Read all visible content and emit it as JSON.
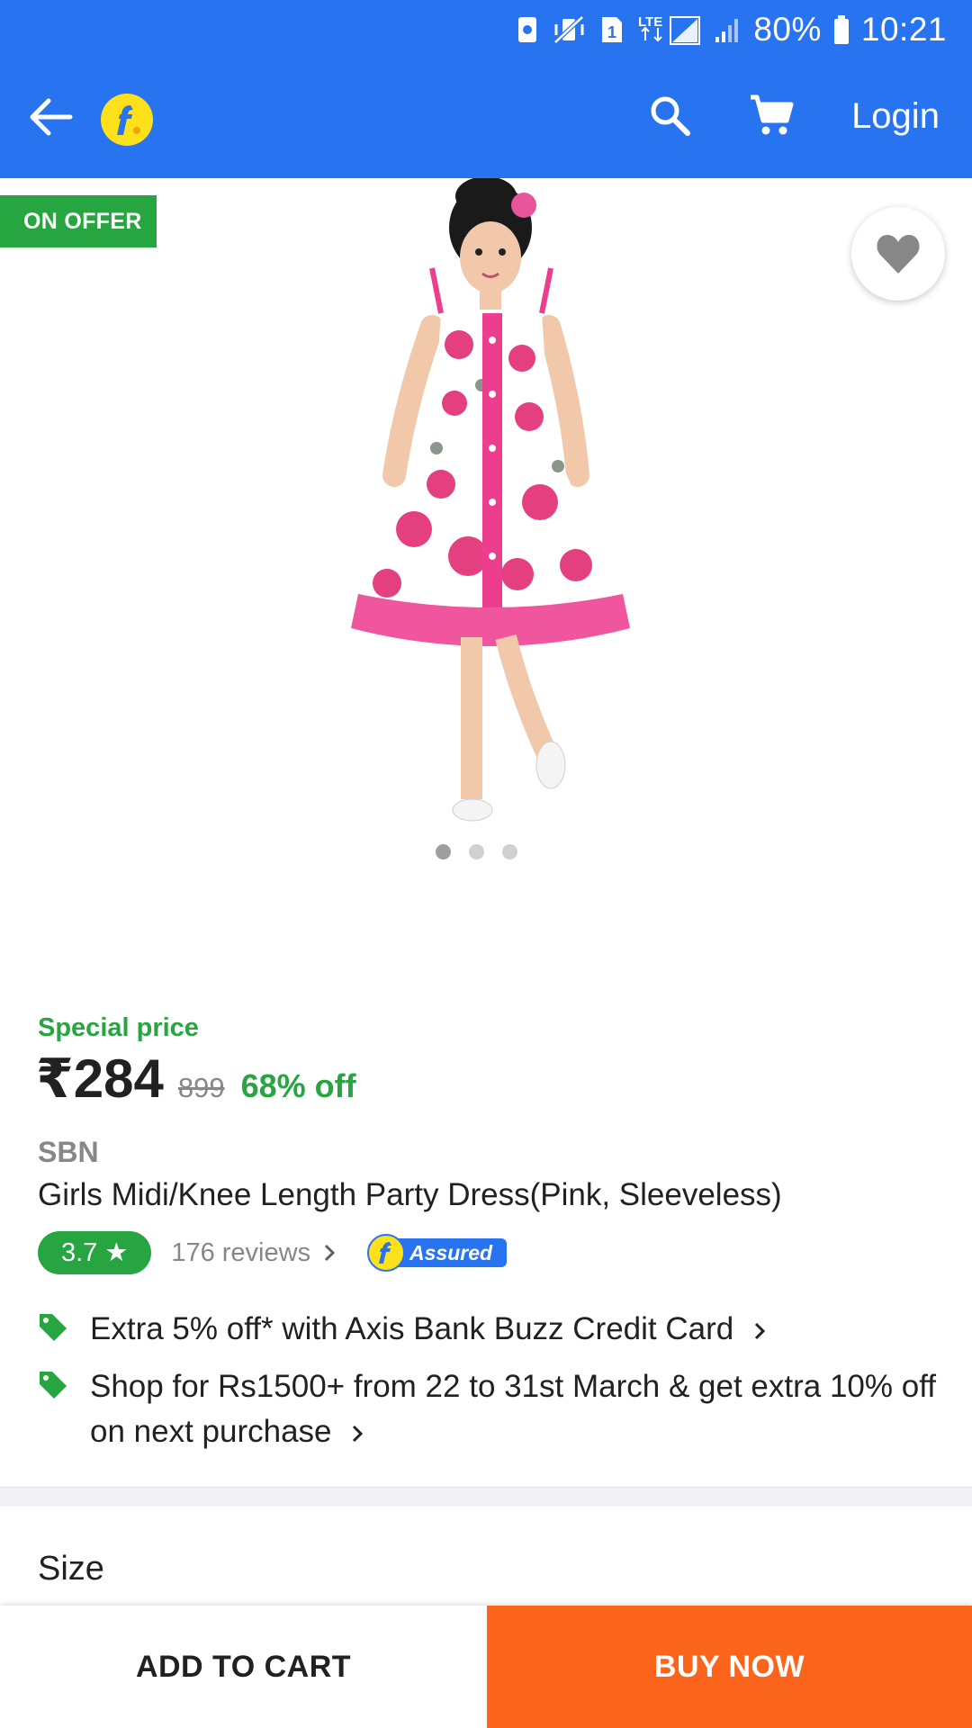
{
  "status_bar": {
    "battery_percent": "80%",
    "time": "10:21",
    "sim_slot": "1",
    "network": "LTE"
  },
  "app_bar": {
    "login_label": "Login",
    "brand_color": "#2874f0"
  },
  "product_media": {
    "offer_badge": "ON OFFER",
    "image_count": 3,
    "active_image": 1
  },
  "pricing": {
    "special_label": "Special price",
    "current_price": "₹284",
    "mrp": "899",
    "discount": "68% off"
  },
  "product": {
    "brand": "SBN",
    "title": "Girls Midi/Knee Length Party Dress(Pink, Sleeveless)",
    "rating": "3.7",
    "rating_star": "★",
    "reviews": "176 reviews",
    "assured_label": "Assured"
  },
  "offers": [
    {
      "text": "Extra 5% off* with Axis Bank Buzz Credit Card"
    },
    {
      "text": "Shop for Rs1500+ from 22 to 31st March & get extra 10% off on next purchase"
    }
  ],
  "size_section": {
    "heading": "Size"
  },
  "actions": {
    "add_to_cart": "ADD TO CART",
    "buy_now": "BUY NOW",
    "buy_now_color": "#fb641b"
  },
  "colors": {
    "accent_green": "#26a541",
    "muted_text": "#878787"
  }
}
